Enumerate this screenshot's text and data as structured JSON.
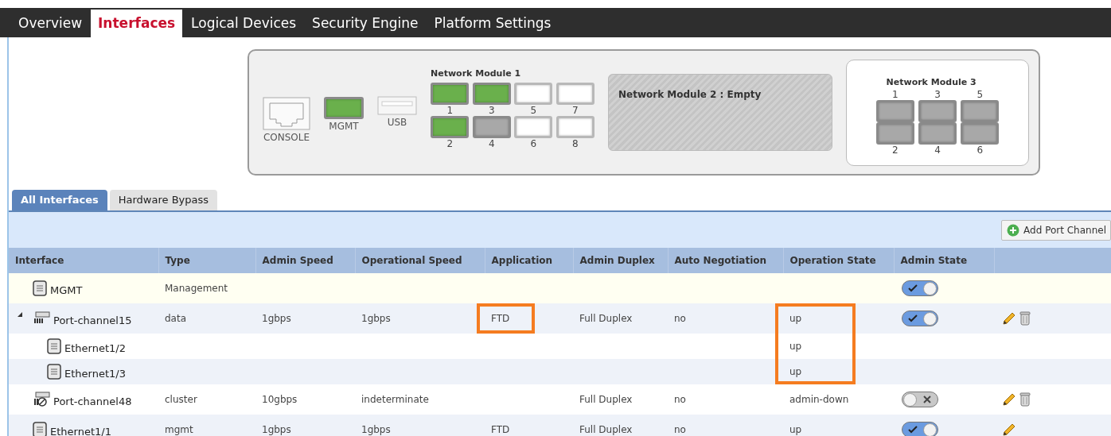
{
  "nav": {
    "tabs": [
      {
        "label": "Overview",
        "selected": false
      },
      {
        "label": "Interfaces",
        "selected": true
      },
      {
        "label": "Logical Devices",
        "selected": false
      },
      {
        "label": "Security Engine",
        "selected": false
      },
      {
        "label": "Platform Settings",
        "selected": false
      }
    ]
  },
  "chassis": {
    "console": "CONSOLE",
    "mgmt": {
      "label": "MGMT",
      "kind": "up"
    },
    "usb": "USB",
    "modules": [
      {
        "kind": "onboard",
        "title": "Network Module 1",
        "top_row": [
          {
            "label": "1",
            "kind": "up"
          },
          {
            "label": "3",
            "kind": "up"
          },
          {
            "label": "5",
            "kind": "empty"
          },
          {
            "label": "7",
            "kind": "empty"
          }
        ],
        "bottom_row": [
          {
            "label": "2",
            "kind": "up"
          },
          {
            "label": "4",
            "kind": "down"
          },
          {
            "label": "6",
            "kind": "empty"
          },
          {
            "label": "8",
            "kind": "empty"
          }
        ]
      },
      {
        "kind": "empty",
        "title": "Network Module 2 : Empty"
      },
      {
        "kind": "expansion",
        "title": "Network Module 3",
        "top_row": [
          {
            "label": "1",
            "kind": "down"
          },
          {
            "label": "3",
            "kind": "down"
          },
          {
            "label": "5",
            "kind": "down"
          }
        ],
        "bottom_row": [
          {
            "label": "2",
            "kind": "down"
          },
          {
            "label": "4",
            "kind": "down"
          },
          {
            "label": "6",
            "kind": "down"
          }
        ]
      }
    ]
  },
  "subtabs": [
    {
      "label": "All Interfaces",
      "selected": true
    },
    {
      "label": "Hardware Bypass",
      "selected": false
    }
  ],
  "toolbar": {
    "button": "Add Port Channel"
  },
  "columns": [
    "Interface",
    "Type",
    "Admin Speed",
    "Operational Speed",
    "Application",
    "Admin Duplex",
    "Auto Negotiation",
    "Operation State",
    "Admin State"
  ],
  "rows": [
    {
      "interface": "MGMT",
      "kind": "port",
      "selected": true,
      "type": "Management",
      "admin_state": {
        "on": true
      }
    },
    {
      "interface": "Port-channel15",
      "kind": "port-channel",
      "selected": false,
      "expanded": true,
      "type": "data",
      "admin_speed": "1gbps",
      "operational_speed": "1gbps",
      "application": "FTD",
      "application_highlighted": true,
      "admin_duplex": "Full Duplex",
      "auto_negotiation": "no",
      "operation_state": "up",
      "operation_state_highlighted": true,
      "admin_state": {
        "on": true
      },
      "editable": true,
      "deletable": true,
      "children": [
        {
          "interface": "Ethernet1/2",
          "kind": "port",
          "selected": false,
          "operation_state": "up",
          "operation_state_highlighted": true
        },
        {
          "interface": "Ethernet1/3",
          "kind": "port",
          "selected": false,
          "operation_state": "up",
          "operation_state_highlighted": true
        }
      ]
    },
    {
      "interface": "Port-channel48",
      "kind": "port-channel-off",
      "selected": false,
      "type": "cluster",
      "admin_speed": "10gbps",
      "operational_speed": "indeterminate",
      "admin_duplex": "Full Duplex",
      "auto_negotiation": "no",
      "operation_state": "admin-down",
      "admin_state": {
        "on": false
      },
      "editable": true,
      "deletable": true
    },
    {
      "interface": "Ethernet1/1",
      "kind": "port",
      "selected": false,
      "type": "mgmt",
      "admin_speed": "1gbps",
      "operational_speed": "1gbps",
      "application": "FTD",
      "admin_duplex": "Full Duplex",
      "auto_negotiation": "no",
      "operation_state": "up",
      "admin_state": {
        "on": true
      },
      "editable": true,
      "deletable": false
    }
  ]
}
